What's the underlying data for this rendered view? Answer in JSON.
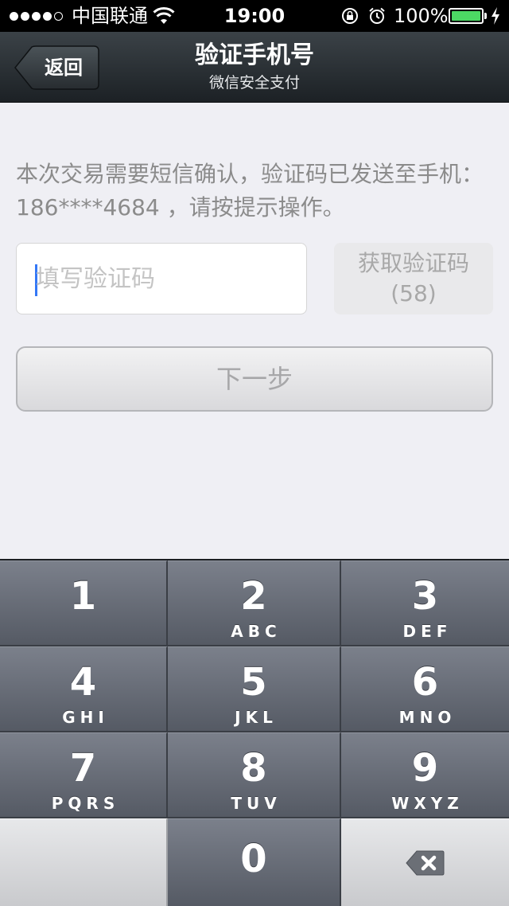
{
  "status_bar": {
    "carrier": "中国联通",
    "time": "19:00",
    "battery_percent": "100%",
    "signal_bars": 4,
    "signal_max": 5
  },
  "nav": {
    "back_label": "返回",
    "title": "验证手机号",
    "subtitle": "微信安全支付"
  },
  "main": {
    "instruction": "本次交易需要短信确认，验证码已发送至手机：186****4684 ，请按提示操作。",
    "code_input_placeholder": "填写验证码",
    "code_input_value": "",
    "get_code_label": "获取验证码",
    "get_code_countdown": "(58)",
    "next_label": "下一步"
  },
  "keypad": {
    "keys": [
      {
        "digit": "1",
        "letters": ""
      },
      {
        "digit": "2",
        "letters": "ABC"
      },
      {
        "digit": "3",
        "letters": "DEF"
      },
      {
        "digit": "4",
        "letters": "GHI"
      },
      {
        "digit": "5",
        "letters": "JKL"
      },
      {
        "digit": "6",
        "letters": "MNO"
      },
      {
        "digit": "7",
        "letters": "PQRS"
      },
      {
        "digit": "8",
        "letters": "TUV"
      },
      {
        "digit": "9",
        "letters": "WXYZ"
      },
      {
        "digit": "0",
        "letters": ""
      }
    ],
    "delete_icon": "backspace-icon"
  },
  "colors": {
    "battery_fill": "#4cd964",
    "nav_bg": "#2a3035",
    "page_bg": "#efeff4",
    "cursor": "#3478f6"
  }
}
